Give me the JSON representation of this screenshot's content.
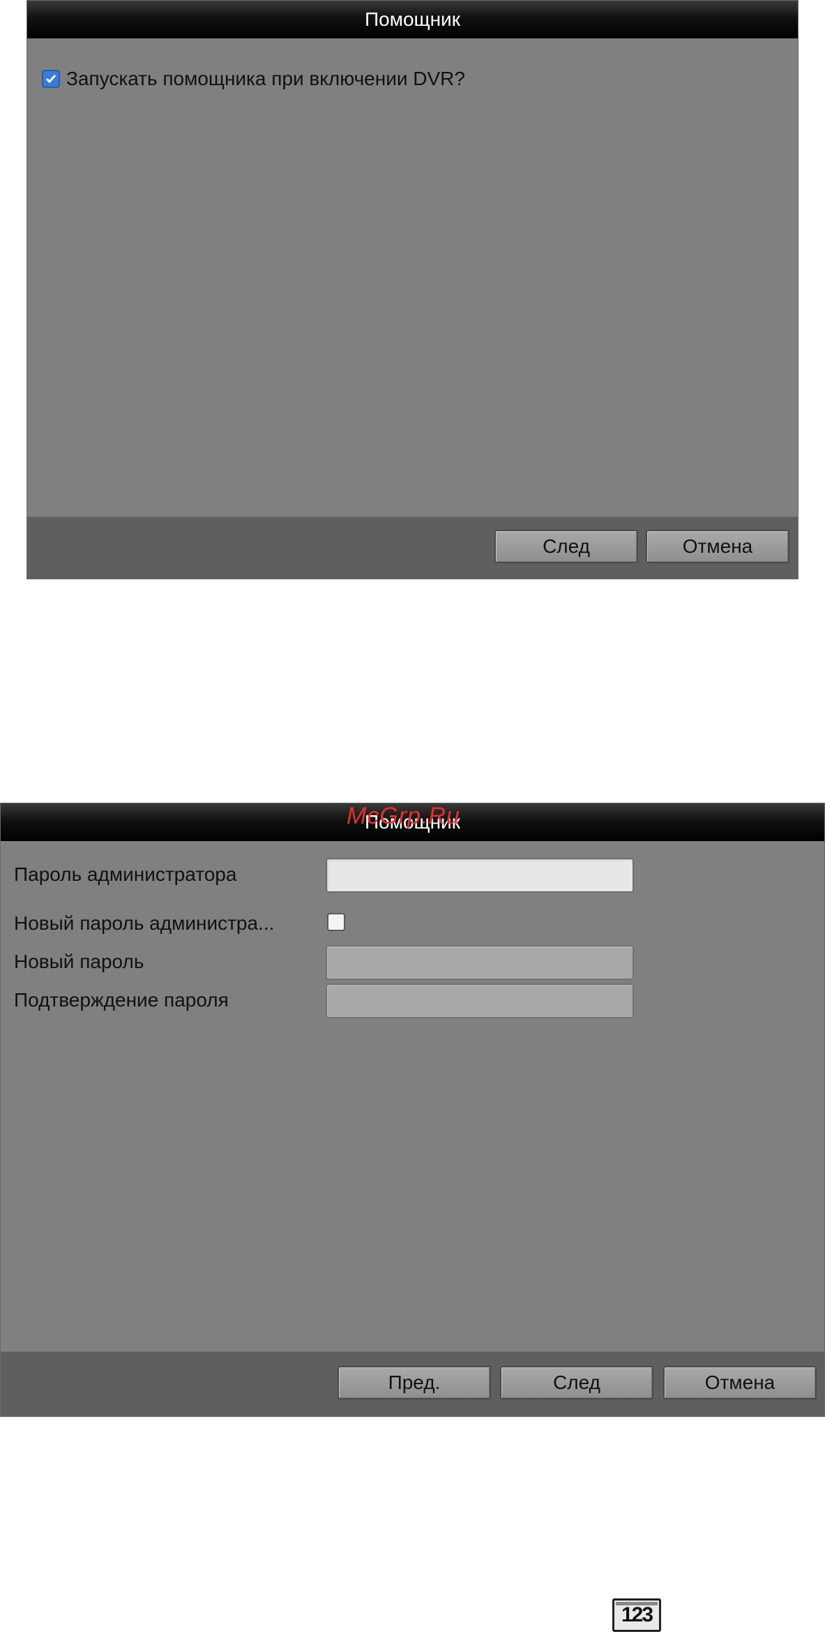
{
  "wizard1": {
    "title": "Помощник",
    "checkbox_label": "Запускать помощника при включении DVR?",
    "checkbox_checked": true,
    "next_label": "След",
    "cancel_label": "Отмена"
  },
  "wizard2": {
    "title": "Помощник",
    "admin_password_label": "Пароль администратора",
    "admin_password_value": "",
    "new_admin_password_label": "Новый пароль администра...",
    "new_admin_password_checked": false,
    "new_password_label": "Новый пароль",
    "new_password_value": "",
    "confirm_password_label": "Подтверждение пароля",
    "confirm_password_value": "",
    "prev_label": "Пред.",
    "next_label": "След",
    "cancel_label": "Отмена"
  },
  "watermark": "McGrp.Ru",
  "keyboard_icon_label": "123",
  "icons": {
    "checkmark": "checkmark-icon",
    "keyboard": "numeric-keyboard-icon"
  },
  "colors": {
    "dialog_bg": "#808080",
    "title_bar": "#000000",
    "footer_bg": "#5f5f5f",
    "checkbox_accent": "#3a7bd5",
    "watermark": "#e03131"
  }
}
